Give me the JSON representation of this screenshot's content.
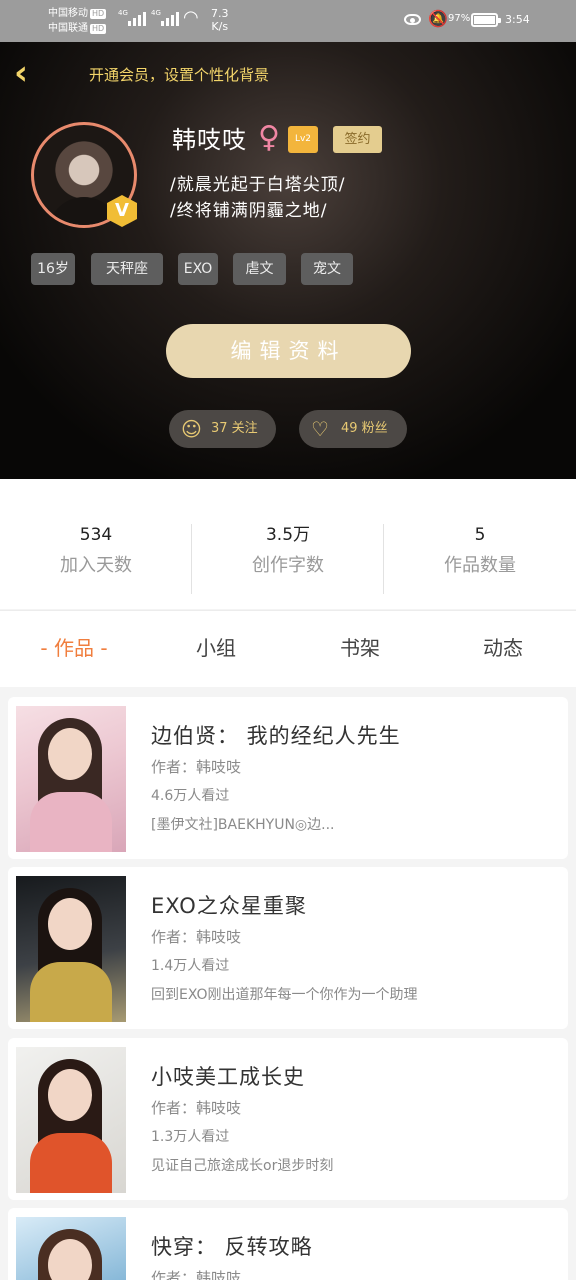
{
  "status_bar": {
    "carrier1": "中国移动",
    "carrier2": "中国联通",
    "hd": "HD",
    "net": "4G",
    "speed_value": "7.3",
    "speed_unit": "K/s",
    "battery": "97%",
    "time": "3:54"
  },
  "header": {
    "vip_link": "开通会员，设置个性化背景",
    "username": "韩吱吱",
    "gender_symbol": "♀",
    "level": "Lv2",
    "signed": "签约",
    "bio_line1": "/就晨光起于白塔尖顶/",
    "bio_line2": "/终将铺满阴霾之地/",
    "tags": [
      "16岁",
      "天秤座",
      "EXO",
      "虐文",
      "宠文"
    ],
    "edit_button": "编辑资料",
    "follow_label": "37 关注",
    "fans_label": "49 粉丝"
  },
  "stats": [
    {
      "value": "534",
      "label": "加入天数"
    },
    {
      "value": "3.5万",
      "label": "创作字数"
    },
    {
      "value": "5",
      "label": "作品数量"
    }
  ],
  "tabs": [
    "- 作品 -",
    "小组",
    "书架",
    "动态"
  ],
  "works": [
    {
      "title": "边伯贤： 我的经纪人先生",
      "author": "作者：韩吱吱",
      "views": "4.6万人看过",
      "desc": "[墨伊文社]BAEKHYUN◎边..."
    },
    {
      "title": "EXO之众星重聚",
      "author": "作者：韩吱吱",
      "views": "1.4万人看过",
      "desc": "回到EXO刚出道那年每一个你作为一个助理"
    },
    {
      "title": "小吱美工成长史",
      "author": "作者：韩吱吱",
      "views": "1.3万人看过",
      "desc": "见证自己旅途成长or退步时刻"
    },
    {
      "title": "快穿： 反转攻略",
      "author": "作者：韩吱吱",
      "views": "",
      "desc": ""
    }
  ],
  "colors": {
    "accent_gold": "#f2d46a",
    "tab_active": "#f07e3e",
    "edit_button_bg": "#e8d7b0",
    "level_badge": "#f3b53c"
  }
}
